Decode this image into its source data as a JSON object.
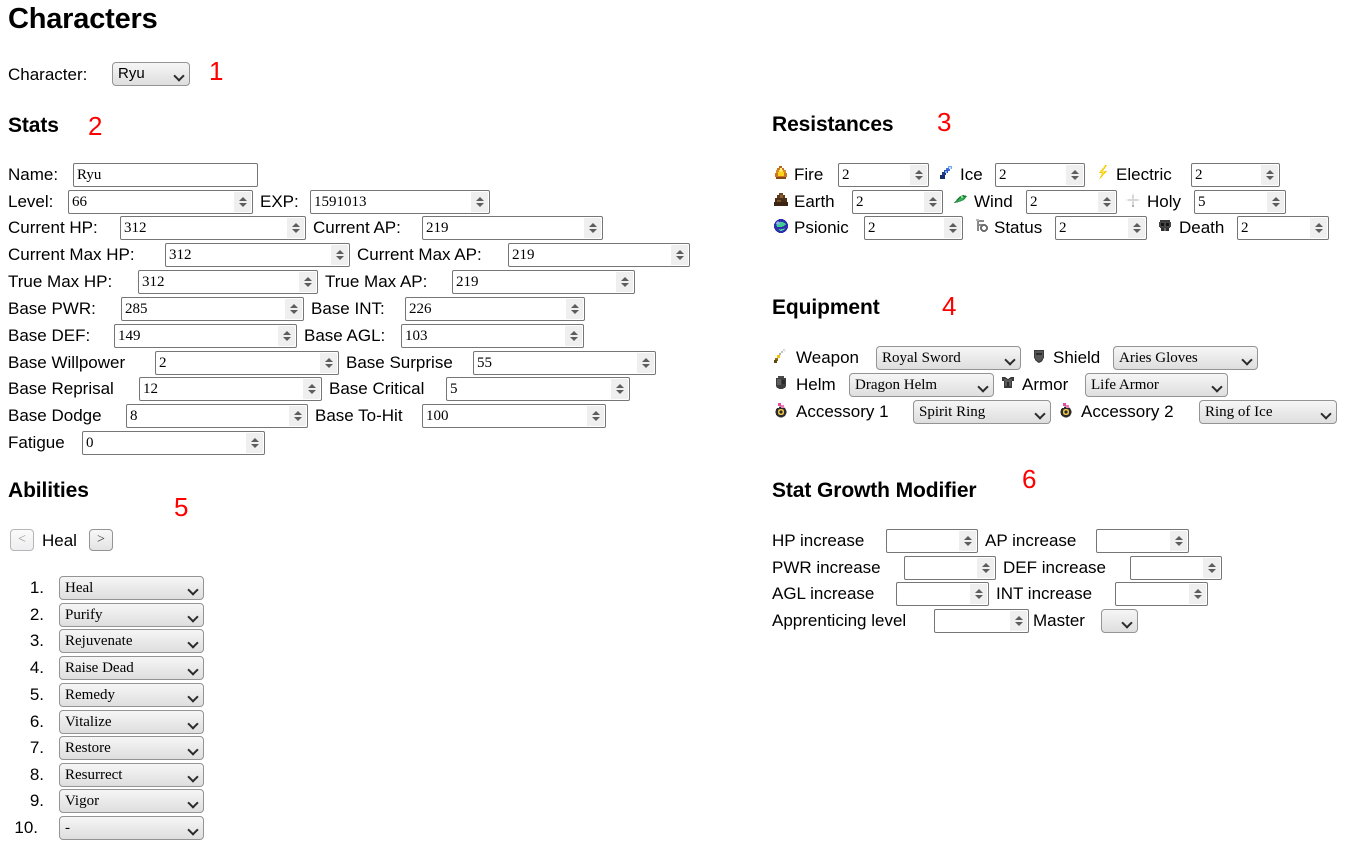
{
  "page": {
    "title": "Characters",
    "character_label": "Character:",
    "character_value": "Ryu",
    "annotations": [
      "1",
      "2",
      "3",
      "4",
      "5",
      "6"
    ],
    "accent_red": "#ff0000"
  },
  "stats": {
    "heading": "Stats",
    "name_label": "Name:",
    "name_value": "Ryu",
    "rows": [
      {
        "label": "Level:",
        "value": "66",
        "label2": "EXP:",
        "value2": "1591013"
      },
      {
        "label": "Current HP:",
        "value": "312",
        "label2": "Current AP:",
        "value2": "219"
      },
      {
        "label": "Current Max HP:",
        "value": "312",
        "label2": "Current Max AP:",
        "value2": "219"
      },
      {
        "label": "True Max HP:",
        "value": "312",
        "label2": "True Max AP:",
        "value2": "219"
      },
      {
        "label": "Base PWR:",
        "value": "285",
        "label2": "Base INT:",
        "value2": "226"
      },
      {
        "label": "Base DEF:",
        "value": "149",
        "label2": "Base AGL:",
        "value2": "103"
      },
      {
        "label": "Base Willpower",
        "value": "2",
        "label2": "Base Surprise",
        "value2": "55"
      },
      {
        "label": "Base Reprisal",
        "value": "12",
        "label2": "Base Critical",
        "value2": "5"
      },
      {
        "label": "Base Dodge",
        "value": "8",
        "label2": "Base To-Hit",
        "value2": "100"
      },
      {
        "label": "Fatigue",
        "value": "0",
        "label2": "",
        "value2": ""
      }
    ]
  },
  "resistances": {
    "heading": "Resistances",
    "items": [
      {
        "icon": "fire-icon",
        "label": "Fire",
        "value": "2"
      },
      {
        "icon": "ice-icon",
        "label": "Ice",
        "value": "2"
      },
      {
        "icon": "electric-icon",
        "label": "Electric",
        "value": "2"
      },
      {
        "icon": "earth-icon",
        "label": "Earth",
        "value": "2"
      },
      {
        "icon": "wind-icon",
        "label": "Wind",
        "value": "2"
      },
      {
        "icon": "holy-icon",
        "label": "Holy",
        "value": "5"
      },
      {
        "icon": "psionic-icon",
        "label": "Psionic",
        "value": "2"
      },
      {
        "icon": "status-icon",
        "label": "Status",
        "value": "2"
      },
      {
        "icon": "death-icon",
        "label": "Death",
        "value": "2"
      }
    ]
  },
  "equipment": {
    "heading": "Equipment",
    "slots": [
      {
        "icon": "weapon-icon",
        "label": "Weapon",
        "value": "Royal Sword"
      },
      {
        "icon": "shield-icon",
        "label": "Shield",
        "value": "Aries Gloves"
      },
      {
        "icon": "helm-icon",
        "label": "Helm",
        "value": "Dragon Helm"
      },
      {
        "icon": "armor-icon",
        "label": "Armor",
        "value": "Life Armor"
      },
      {
        "icon": "accessory-icon",
        "label": "Accessory 1",
        "value": "Spirit Ring"
      },
      {
        "icon": "accessory-icon",
        "label": "Accessory 2",
        "value": "Ring of Ice"
      }
    ]
  },
  "abilities": {
    "heading": "Abilities",
    "prev_label": "<",
    "next_label": ">",
    "current": "Heal",
    "list": [
      {
        "index": "1.",
        "value": "Heal"
      },
      {
        "index": "2.",
        "value": "Purify"
      },
      {
        "index": "3.",
        "value": "Rejuvenate"
      },
      {
        "index": "4.",
        "value": "Raise Dead"
      },
      {
        "index": "5.",
        "value": "Remedy"
      },
      {
        "index": "6.",
        "value": "Vitalize"
      },
      {
        "index": "7.",
        "value": "Restore"
      },
      {
        "index": "8.",
        "value": "Resurrect"
      },
      {
        "index": "9.",
        "value": "Vigor"
      },
      {
        "index": "10.",
        "value": "-"
      }
    ]
  },
  "growth": {
    "heading": "Stat Growth Modifier",
    "rows": [
      {
        "label": "HP increase",
        "value": "",
        "label2": "AP increase",
        "value2": ""
      },
      {
        "label": "PWR increase",
        "value": "",
        "label2": "DEF increase",
        "value2": ""
      },
      {
        "label": "AGL increase",
        "value": "",
        "label2": "INT increase",
        "value2": ""
      },
      {
        "label": "Apprenticing level",
        "value": "",
        "label2": "Master",
        "value2": ""
      }
    ],
    "master_value": ""
  }
}
